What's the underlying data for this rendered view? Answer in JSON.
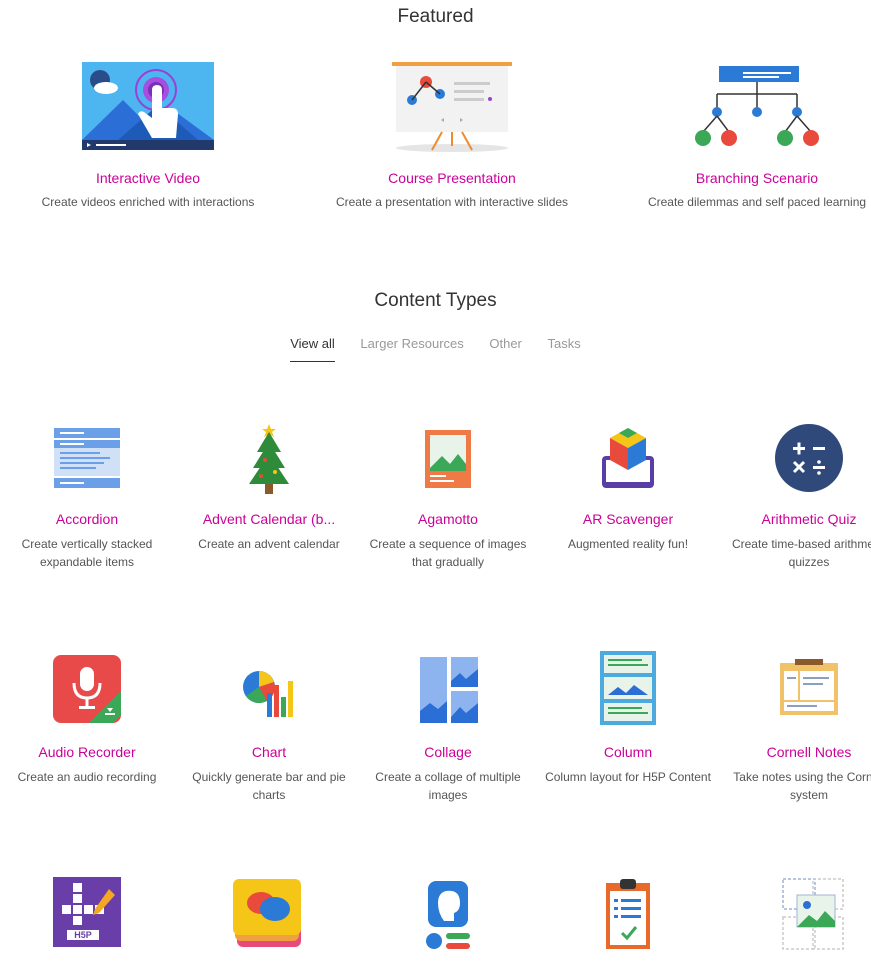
{
  "featured": {
    "title": "Featured",
    "items": [
      {
        "name": "Interactive Video",
        "desc": "Create videos enriched with interactions",
        "icon": "interactive-video-icon"
      },
      {
        "name": "Course Presentation",
        "desc": "Create a presentation with interactive slides",
        "icon": "course-presentation-icon"
      },
      {
        "name": "Branching Scenario",
        "desc": "Create dilemmas and self paced learning",
        "icon": "branching-scenario-icon"
      }
    ]
  },
  "content_types": {
    "title": "Content Types",
    "tabs": [
      "View all",
      "Larger Resources",
      "Other",
      "Tasks"
    ],
    "active_tab": "View all",
    "items": [
      {
        "name": "Accordion",
        "desc": "Create vertically stacked expandable items",
        "icon": "accordion-icon"
      },
      {
        "name": "Advent Calendar (b...",
        "desc": "Create an advent calendar",
        "icon": "christmas-tree-icon"
      },
      {
        "name": "Agamotto",
        "desc": "Create a sequence of images that gradually",
        "icon": "image-sequence-icon"
      },
      {
        "name": "AR Scavenger",
        "desc": "Augmented reality fun!",
        "icon": "ar-cube-icon"
      },
      {
        "name": "Arithmetic Quiz",
        "desc": "Create time-based arithmetic quizzes",
        "icon": "arithmetic-icon"
      },
      {
        "name": "Audio Recorder",
        "desc": "Create an audio recording",
        "icon": "microphone-icon"
      },
      {
        "name": "Chart",
        "desc": "Quickly generate bar and pie charts",
        "icon": "chart-icon"
      },
      {
        "name": "Collage",
        "desc": "Create a collage of multiple images",
        "icon": "collage-icon"
      },
      {
        "name": "Column",
        "desc": "Column layout for H5P Content",
        "icon": "column-icon"
      },
      {
        "name": "Cornell Notes",
        "desc": "Take notes using the Cornell system",
        "icon": "cornell-notes-icon"
      },
      {
        "name": "",
        "desc": "",
        "icon": "crossword-icon",
        "icon_text": "H5P"
      },
      {
        "name": "",
        "desc": "",
        "icon": "dialog-cards-icon"
      },
      {
        "name": "",
        "desc": "",
        "icon": "speak-words-icon"
      },
      {
        "name": "",
        "desc": "",
        "icon": "checklist-icon"
      },
      {
        "name": "",
        "desc": "",
        "icon": "drag-image-icon"
      }
    ]
  },
  "colors": {
    "accent": "#cc0099",
    "text": "#333333",
    "muted": "#999999"
  }
}
